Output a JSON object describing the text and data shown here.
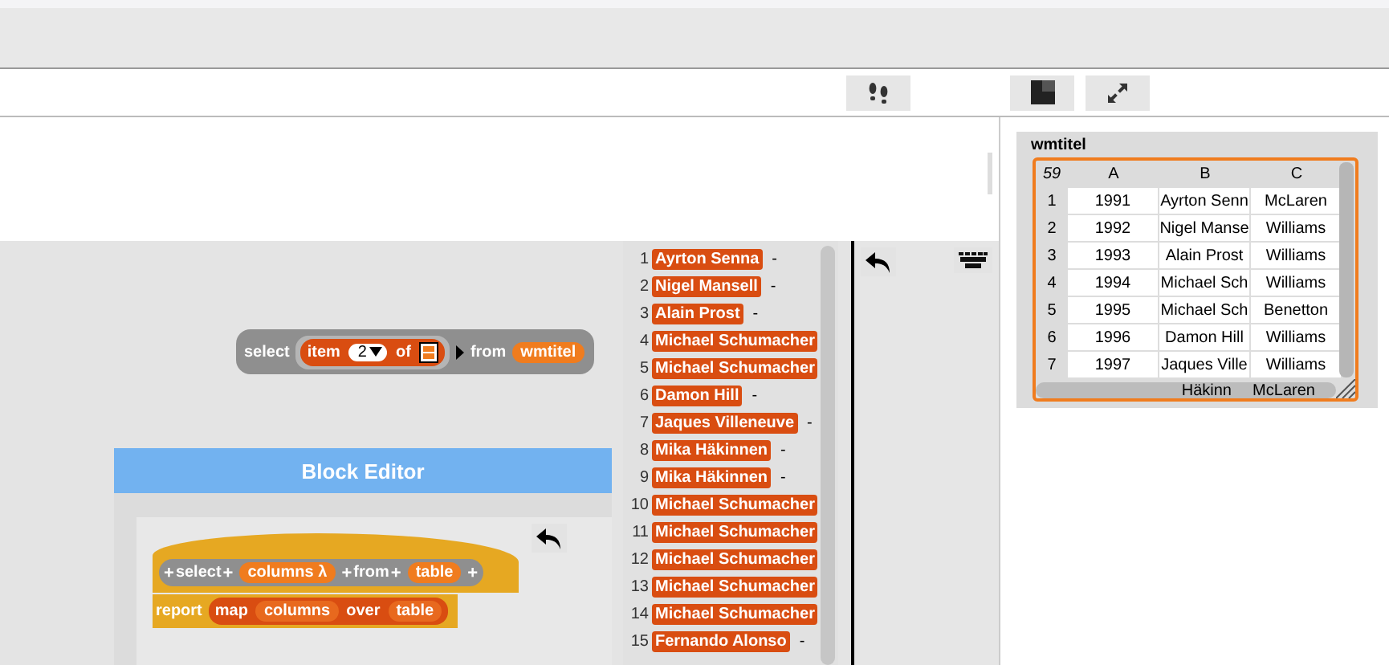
{
  "script_block": {
    "parts": [
      {
        "kind": "word",
        "text": "select"
      },
      {
        "kind": "multi",
        "parts": [
          {
            "kind": "reporter",
            "parts": [
              {
                "kind": "word",
                "text": "item"
              },
              {
                "kind": "dropdown",
                "text": "2"
              },
              {
                "kind": "word",
                "text": "of"
              },
              {
                "kind": "list-icon"
              }
            ]
          }
        ]
      },
      {
        "kind": "arrow"
      },
      {
        "kind": "word",
        "text": "from"
      },
      {
        "kind": "slot",
        "text": "wmtitel"
      }
    ]
  },
  "block_editor": {
    "title": "Block Editor",
    "prototype": [
      {
        "kind": "plus",
        "text": "+"
      },
      {
        "kind": "word",
        "text": "select"
      },
      {
        "kind": "plus",
        "text": "+"
      },
      {
        "kind": "slot",
        "text": "columns λ"
      },
      {
        "kind": "plus",
        "text": "+"
      },
      {
        "kind": "word",
        "text": "from"
      },
      {
        "kind": "plus",
        "text": "+"
      },
      {
        "kind": "slot",
        "text": "table"
      },
      {
        "kind": "plus",
        "text": "+"
      }
    ],
    "command": [
      {
        "kind": "word",
        "text": "report"
      },
      {
        "kind": "reporter",
        "parts": [
          {
            "kind": "word",
            "text": "map"
          },
          {
            "kind": "slot",
            "text": "columns"
          },
          {
            "kind": "word",
            "text": "over"
          },
          {
            "kind": "slot",
            "text": "table"
          }
        ]
      }
    ]
  },
  "list_watcher": {
    "items": [
      {
        "index": "1",
        "value": "Ayrton Senna",
        "trailing": "-"
      },
      {
        "index": "2",
        "value": "Nigel Mansell",
        "trailing": "-"
      },
      {
        "index": "3",
        "value": "Alain Prost",
        "trailing": "-"
      },
      {
        "index": "4",
        "value": "Michael Schumacher"
      },
      {
        "index": "5",
        "value": "Michael Schumacher"
      },
      {
        "index": "6",
        "value": "Damon Hill",
        "trailing": "-"
      },
      {
        "index": "7",
        "value": "Jaques Villeneuve",
        "trailing": "-"
      },
      {
        "index": "8",
        "value": "Mika Häkinnen",
        "trailing": "-"
      },
      {
        "index": "9",
        "value": "Mika Häkinnen",
        "trailing": "-"
      },
      {
        "index": "10",
        "value": "Michael Schumacher"
      },
      {
        "index": "11",
        "value": "Michael Schumacher"
      },
      {
        "index": "12",
        "value": "Michael Schumacher"
      },
      {
        "index": "13",
        "value": "Michael Schumacher"
      },
      {
        "index": "14",
        "value": "Michael Schumacher"
      },
      {
        "index": "15",
        "value": "Fernando Alonso",
        "trailing": "-"
      }
    ]
  },
  "stage": {
    "watcher": {
      "name": "wmtitel",
      "columns": [
        "59",
        "A",
        "B",
        "C"
      ],
      "rows": [
        [
          "1",
          "1991",
          "Ayrton Senn",
          "McLaren"
        ],
        [
          "2",
          "1992",
          "Nigel Manse",
          "Williams"
        ],
        [
          "3",
          "1993",
          "Alain Prost",
          "Williams"
        ],
        [
          "4",
          "1994",
          "Michael Sch",
          "Williams"
        ],
        [
          "5",
          "1995",
          "Michael Sch",
          "Benetton"
        ],
        [
          "6",
          "1996",
          "Damon Hill",
          "Williams"
        ],
        [
          "7",
          "1997",
          "Jaques Ville",
          "Williams"
        ]
      ],
      "partial_row": [
        "Häkinn",
        "McLaren"
      ]
    }
  }
}
